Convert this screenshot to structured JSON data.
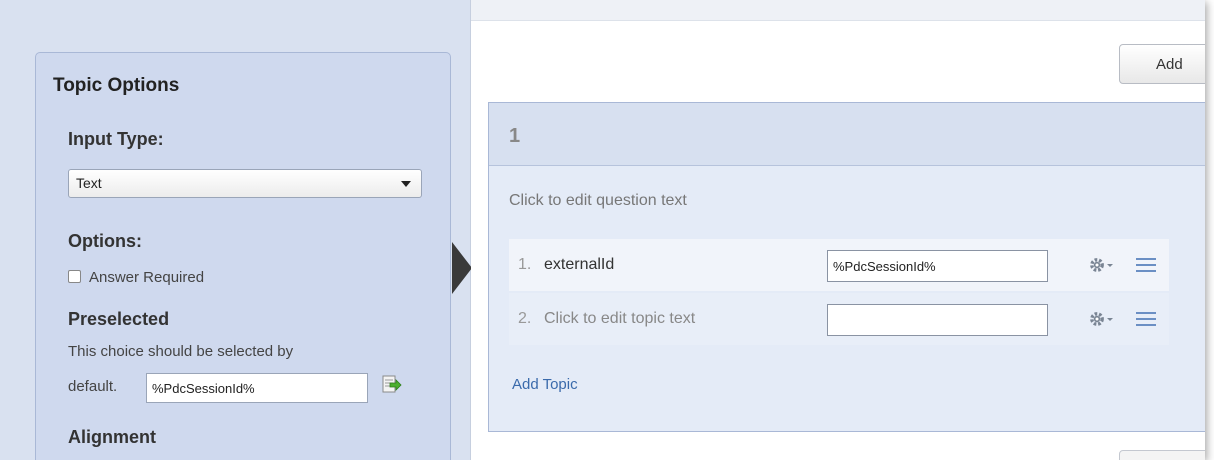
{
  "topic_options": {
    "title": "Topic Options",
    "input_type_label": "Input Type:",
    "input_type_value": "Text",
    "options_label": "Options:",
    "answer_required_label": "Answer Required",
    "answer_required_checked": false,
    "preselected_label": "Preselected",
    "preselected_description": "This choice should be selected by",
    "default_label": "default.",
    "default_value": "%PdcSessionId%",
    "alignment_label": "Alignment"
  },
  "editor": {
    "add_button_label": "Add",
    "question": {
      "number": "1",
      "text_placeholder": "Click to edit question text",
      "topics": [
        {
          "index": "1.",
          "label": "externalId",
          "value": "%PdcSessionId%"
        },
        {
          "index": "2.",
          "label": "Click to edit topic text",
          "value": ""
        }
      ],
      "add_topic_label": "Add Topic"
    }
  },
  "colors": {
    "panel_bg": "#cfd9ee",
    "question_bg": "#e4ebf7",
    "link": "#3a6aab",
    "icon_blue": "#6b8fc4"
  }
}
